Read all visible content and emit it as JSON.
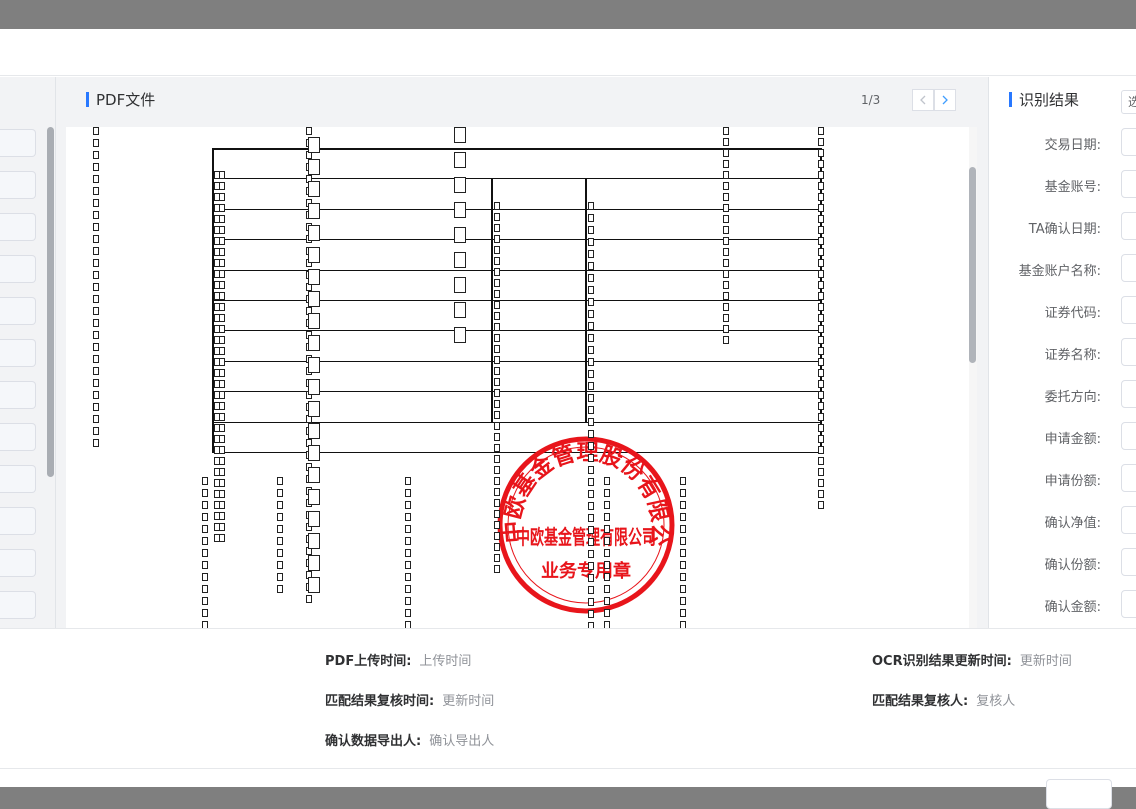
{
  "pdf_panel": {
    "title": "PDF文件",
    "page_indicator": "1/3",
    "prev_icon": "chevron-left-icon",
    "next_icon": "chevron-right-icon",
    "stamp": {
      "text_outer": "中欧基金管理股份有限公司",
      "text_inner": "中欧基金管理有限公司",
      "text_bottom": "业务专用章",
      "color": "#e8151b"
    }
  },
  "result_panel": {
    "title": "识别结果",
    "select_value": "选",
    "fields": [
      {
        "label": "交易日期:"
      },
      {
        "label": "基金账号:"
      },
      {
        "label": "TA确认日期:"
      },
      {
        "label": "基金账户名称:"
      },
      {
        "label": "证券代码:"
      },
      {
        "label": "证券名称:"
      },
      {
        "label": "委托方向:"
      },
      {
        "label": "申请金额:"
      },
      {
        "label": "申请份额:"
      },
      {
        "label": "确认净值:"
      },
      {
        "label": "确认份额:"
      },
      {
        "label": "确认金额:"
      }
    ]
  },
  "meta": {
    "pdf_upload_time_label": "PDF上传时间:",
    "pdf_upload_time_value": "上传时间",
    "ocr_update_time_label": "OCR识别结果更新时间:",
    "ocr_update_time_value": "更新时间",
    "match_review_time_label": "匹配结果复核时间:",
    "match_review_time_value": "更新时间",
    "match_reviewer_label": "匹配结果复核人:",
    "match_reviewer_value": "复核人",
    "export_user_label": "确认数据导出人:",
    "export_user_value": "确认导出人"
  },
  "colors": {
    "accent": "#2878ff",
    "overlay": "#7f7f7f"
  }
}
